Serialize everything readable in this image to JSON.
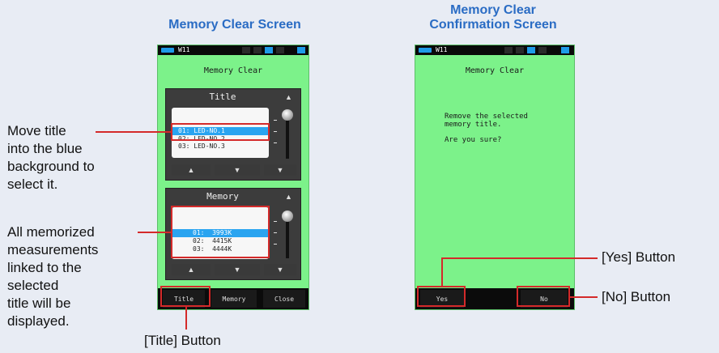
{
  "headings": {
    "left": "Memory Clear Screen",
    "right_line1": "Memory Clear",
    "right_line2": "Confirmation Screen"
  },
  "notes": {
    "move_title": [
      "Move title",
      "into the blue",
      "background to",
      "select it."
    ],
    "memorized": [
      "All memorized",
      "measurements",
      "linked to the",
      "selected",
      "title will be",
      "displayed."
    ]
  },
  "callouts": {
    "title_button": "[Title] Button",
    "yes_button": "[Yes] Button",
    "no_button": "[No] Button"
  },
  "device_left": {
    "status_text": "W11",
    "screen_title": "Memory Clear",
    "title_panel": {
      "label": "Title",
      "rows": [
        "01: LED-NO.1",
        "02: LED-NO.2",
        "03: LED-NO.3"
      ],
      "selected_index": 0
    },
    "memory_panel": {
      "label": "Memory",
      "rows": [
        "01:  3993K",
        "02:  4415K",
        "03:  4444K"
      ],
      "selected_index": 0
    },
    "buttons": {
      "title": "Title",
      "memory": "Memory",
      "close": "Close"
    }
  },
  "device_right": {
    "status_text": "W11",
    "screen_title": "Memory Clear",
    "message_line1": "Remove the selected",
    "message_line2": "memory title.",
    "question": "Are you sure?",
    "buttons": {
      "yes": "Yes",
      "no": "No"
    }
  },
  "colors": {
    "heading": "#2a6cc4",
    "screen_bg": "#7cf28a",
    "selection": "#2aa4f0",
    "highlight": "#d42a2a"
  }
}
